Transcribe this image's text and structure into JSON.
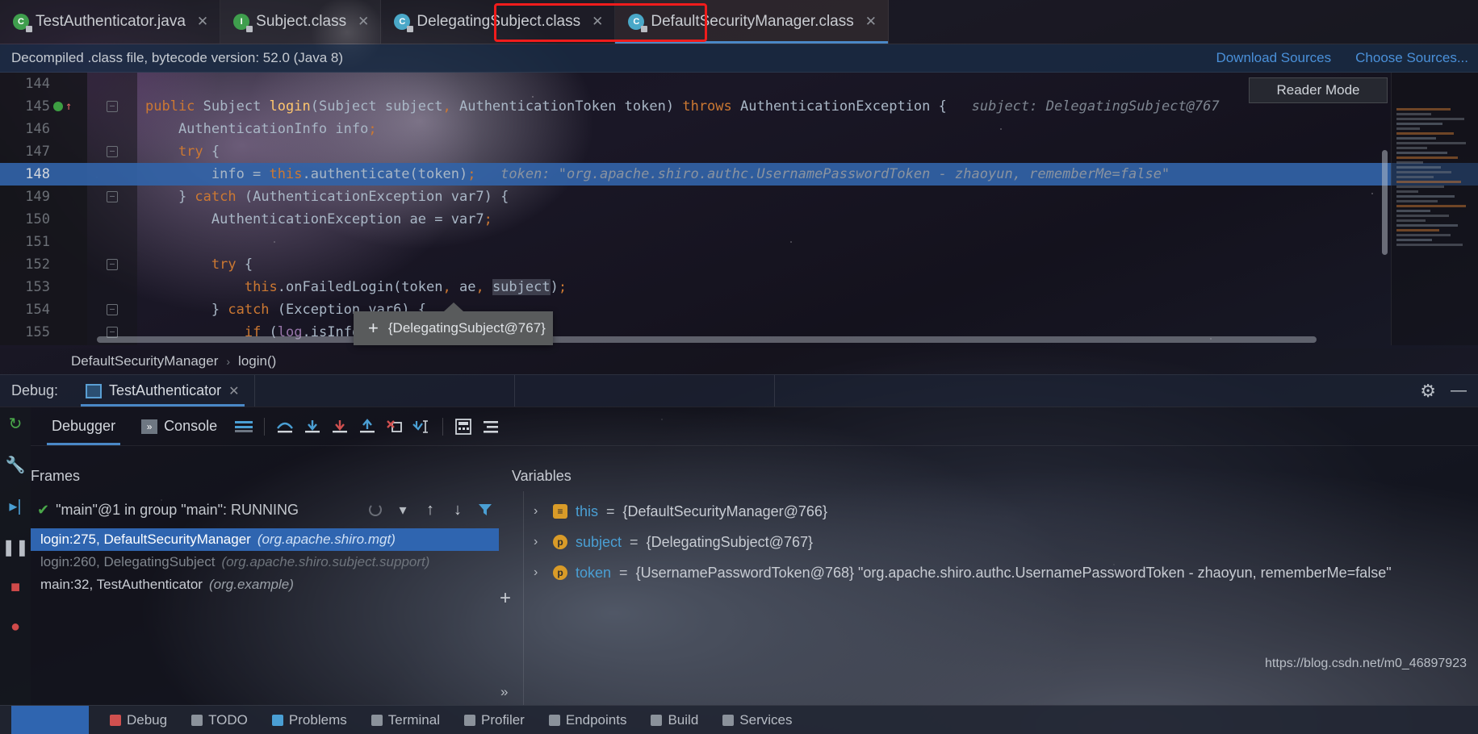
{
  "tabs": [
    {
      "label": "TestAuthenticator.java",
      "icon": "java-class-icon",
      "icon_kind": "grn",
      "close": "✕",
      "letter": "C",
      "active": false
    },
    {
      "label": "Subject.class",
      "icon": "interface-class-icon",
      "icon_kind": "grn",
      "close": "✕",
      "letter": "I",
      "active": false
    },
    {
      "label": "DelegatingSubject.class",
      "icon": "class-file-icon",
      "icon_kind": "cls",
      "close": "✕",
      "letter": "C",
      "active": false
    },
    {
      "label": "DefaultSecurityManager.class",
      "icon": "class-file-icon",
      "icon_kind": "cls",
      "close": "✕",
      "letter": "C",
      "active": true
    }
  ],
  "banner": {
    "text": "Decompiled .class file, bytecode version: 52.0 (Java 8)",
    "download_sources": "Download Sources",
    "choose_sources": "Choose Sources..."
  },
  "editor": {
    "reader_mode": "Reader Mode",
    "lines": [
      {
        "num": "144",
        "segments": []
      },
      {
        "num": "145",
        "segments": [
          {
            "t": "public ",
            "c": "kw"
          },
          {
            "t": "Subject ",
            "c": "idn"
          },
          {
            "t": "login",
            "c": "fn"
          },
          {
            "t": "(Subject subject",
            "c": "idn"
          },
          {
            "t": ", ",
            "c": "semi"
          },
          {
            "t": "AuthenticationToken token",
            "c": "idn"
          },
          {
            "t": ")",
            "c": "idn"
          },
          {
            "t": " throws ",
            "c": "kw"
          },
          {
            "t": "AuthenticationException ",
            "c": "idn"
          },
          {
            "t": "{",
            "c": "idn"
          },
          {
            "t": "   subject: DelegatingSubject@767",
            "c": "hint"
          }
        ]
      },
      {
        "num": "146",
        "segments": [
          {
            "t": "    AuthenticationInfo info",
            "c": "idn"
          },
          {
            "t": ";",
            "c": "semi"
          }
        ]
      },
      {
        "num": "147",
        "segments": [
          {
            "t": "    try",
            "c": "kw"
          },
          {
            "t": " {",
            "c": "idn"
          }
        ]
      },
      {
        "num": "148",
        "highlight": true,
        "segments": [
          {
            "t": "        info = ",
            "c": "idn"
          },
          {
            "t": "this",
            "c": "kw"
          },
          {
            "t": ".authenticate(token)",
            "c": "idn"
          },
          {
            "t": ";",
            "c": "semi"
          },
          {
            "t": "   token: \"org.apache.shiro.authc.UsernamePasswordToken - zhaoyun, rememberMe=false\"",
            "c": "hint-b"
          }
        ]
      },
      {
        "num": "149",
        "segments": [
          {
            "t": "    } ",
            "c": "idn"
          },
          {
            "t": "catch",
            "c": "kw"
          },
          {
            "t": " (AuthenticationException var7) {",
            "c": "idn"
          }
        ]
      },
      {
        "num": "150",
        "segments": [
          {
            "t": "        AuthenticationException ae = var7",
            "c": "idn"
          },
          {
            "t": ";",
            "c": "semi"
          }
        ]
      },
      {
        "num": "151",
        "segments": []
      },
      {
        "num": "152",
        "segments": [
          {
            "t": "        try",
            "c": "kw"
          },
          {
            "t": " {",
            "c": "idn"
          }
        ]
      },
      {
        "num": "153",
        "segments": [
          {
            "t": "            ",
            "c": "idn"
          },
          {
            "t": "this",
            "c": "kw"
          },
          {
            "t": ".onFailedLogin(token",
            "c": "idn"
          },
          {
            "t": ", ",
            "c": "semi"
          },
          {
            "t": "ae",
            "c": "idn"
          },
          {
            "t": ", ",
            "c": "semi"
          },
          {
            "t": "subject",
            "c": "sel-tok idn"
          },
          {
            "t": ")",
            "c": "idn"
          },
          {
            "t": ";",
            "c": "semi"
          }
        ]
      },
      {
        "num": "154",
        "segments": [
          {
            "t": "        } ",
            "c": "idn"
          },
          {
            "t": "catch",
            "c": "kw"
          },
          {
            "t": " (Exception var6) {",
            "c": "idn"
          }
        ]
      },
      {
        "num": "155",
        "segments": [
          {
            "t": "            ",
            "c": "idn"
          },
          {
            "t": "if",
            "c": "kw"
          },
          {
            "t": " (",
            "c": "idn"
          },
          {
            "t": "log",
            "c": "fld"
          },
          {
            "t": ".isInfoEnab",
            "c": "idn"
          }
        ]
      }
    ]
  },
  "tooltip": {
    "plus": "+",
    "text": "{DelegatingSubject@767}"
  },
  "breadcrumb": {
    "class": "DefaultSecurityManager",
    "sep": "›",
    "method": "login()"
  },
  "debug_header": {
    "label": "Debug:",
    "config_name": "TestAuthenticator",
    "close": "✕",
    "gear": "⚙",
    "minimize": "—"
  },
  "debug_toolbar": {
    "debugger_tab": "Debugger",
    "console_tab": "Console",
    "icons": [
      "layout-icon",
      "step-over-icon",
      "step-into-icon",
      "force-step-into-icon",
      "step-out-icon",
      "drop-frame-icon",
      "run-to-cursor-icon",
      "evaluate-expression-icon",
      "settings-lines-icon"
    ]
  },
  "frames": {
    "header": "Frames",
    "thread": "\"main\"@1 in group \"main\": RUNNING",
    "check": "✔",
    "rows": [
      {
        "label": "login:275, DefaultSecurityManager",
        "pkg": "(org.apache.shiro.mgt)",
        "selected": true,
        "dim": false
      },
      {
        "label": "login:260, DelegatingSubject",
        "pkg": "(org.apache.shiro.subject.support)",
        "selected": false,
        "dim": true
      },
      {
        "label": "main:32, TestAuthenticator",
        "pkg": "(org.example)",
        "selected": false,
        "dim": false
      }
    ],
    "dots": "»"
  },
  "variables": {
    "header": "Variables",
    "rows": [
      {
        "chev": "›",
        "badge": "≡",
        "badge_kind": "orange",
        "name": "this",
        "eq": " = ",
        "value": "{DefaultSecurityManager@766}"
      },
      {
        "chev": "›",
        "badge": "p",
        "badge_kind": "p",
        "name": "subject",
        "eq": " = ",
        "value": "{DelegatingSubject@767}"
      },
      {
        "chev": "›",
        "badge": "p",
        "badge_kind": "p",
        "name": "token",
        "eq": " = ",
        "value": "{UsernamePasswordToken@768} \"org.apache.shiro.authc.UsernamePasswordToken - zhaoyun, rememberMe=false\""
      }
    ]
  },
  "watermark": "https://blog.csdn.net/m0_46897923",
  "status_bar": {
    "items": [
      "Debug",
      "TODO",
      "Problems",
      "Terminal",
      "Profiler",
      "Endpoints",
      "Build",
      "Services"
    ]
  },
  "colors": {
    "accent": "#4a88c7",
    "highlight_row": "#3263a7",
    "selection": "#2f65b0",
    "redbox": "#f01c1c",
    "link": "#4a90d9"
  }
}
